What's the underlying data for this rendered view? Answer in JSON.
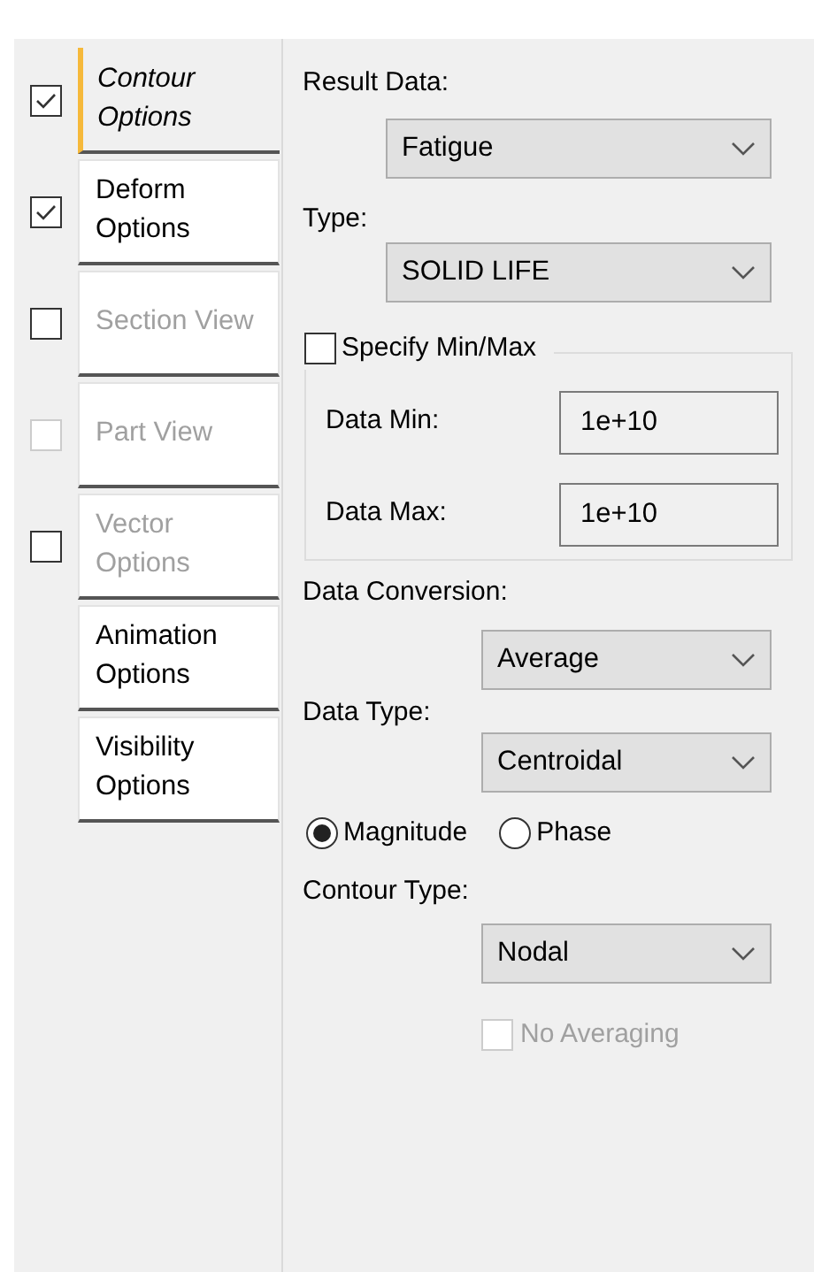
{
  "tabs": [
    {
      "label": "Contour Options",
      "selected": true,
      "disabled": false,
      "checkbox": {
        "checked": true,
        "disabled": false
      }
    },
    {
      "label": "Deform Options",
      "selected": false,
      "disabled": false,
      "checkbox": {
        "checked": true,
        "disabled": false
      }
    },
    {
      "label": "Section View",
      "selected": false,
      "disabled": true,
      "checkbox": {
        "checked": false,
        "disabled": false
      }
    },
    {
      "label": "Part View",
      "selected": false,
      "disabled": true,
      "checkbox": {
        "checked": false,
        "disabled": true
      }
    },
    {
      "label": "Vector Options",
      "selected": false,
      "disabled": true,
      "checkbox": {
        "checked": false,
        "disabled": false
      }
    },
    {
      "label": "Animation Options",
      "selected": false,
      "disabled": false
    },
    {
      "label": "Visibility Options",
      "selected": false,
      "disabled": false
    }
  ],
  "result_data": {
    "label": "Result Data:",
    "value": "Fatigue"
  },
  "type": {
    "label": "Type:",
    "value": "SOLID LIFE"
  },
  "min_max": {
    "label": "Specify Min/Max",
    "checked": false,
    "fields": [
      {
        "label": "Data Min:",
        "value": "1e+10"
      },
      {
        "label": "Data Max:",
        "value": "1e+10"
      }
    ]
  },
  "data_conversion": {
    "label": "Data Conversion:",
    "value": "Average"
  },
  "data_type": {
    "label": "Data Type:",
    "value": "Centroidal"
  },
  "radios": [
    {
      "label": "Magnitude",
      "selected": true
    },
    {
      "label": "Phase",
      "selected": false
    }
  ],
  "contour_type": {
    "label": "Contour Type:",
    "value": "Nodal"
  },
  "no_averaging": {
    "label": "No Averaging",
    "checked": false,
    "disabled": true
  }
}
